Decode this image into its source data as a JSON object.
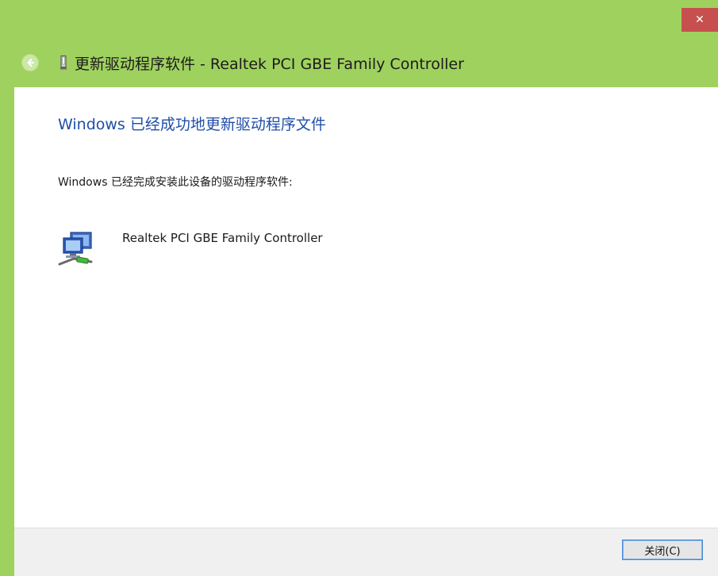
{
  "window": {
    "title": "更新驱动程序软件 - Realtek PCI GBE Family Controller",
    "close_glyph": "✕",
    "frame_color": "#9fd15f",
    "close_color": "#c7504f"
  },
  "content": {
    "heading": "Windows 已经成功地更新驱动程序文件",
    "description": "Windows 已经完成安装此设备的驱动程序软件:",
    "device": {
      "name": "Realtek PCI GBE Family Controller",
      "icon": "network-adapter-icon"
    }
  },
  "footer": {
    "close_label": "关闭(C)"
  },
  "icons": {
    "back": "back-arrow-icon",
    "app": "usb-device-icon",
    "close": "close-icon"
  }
}
